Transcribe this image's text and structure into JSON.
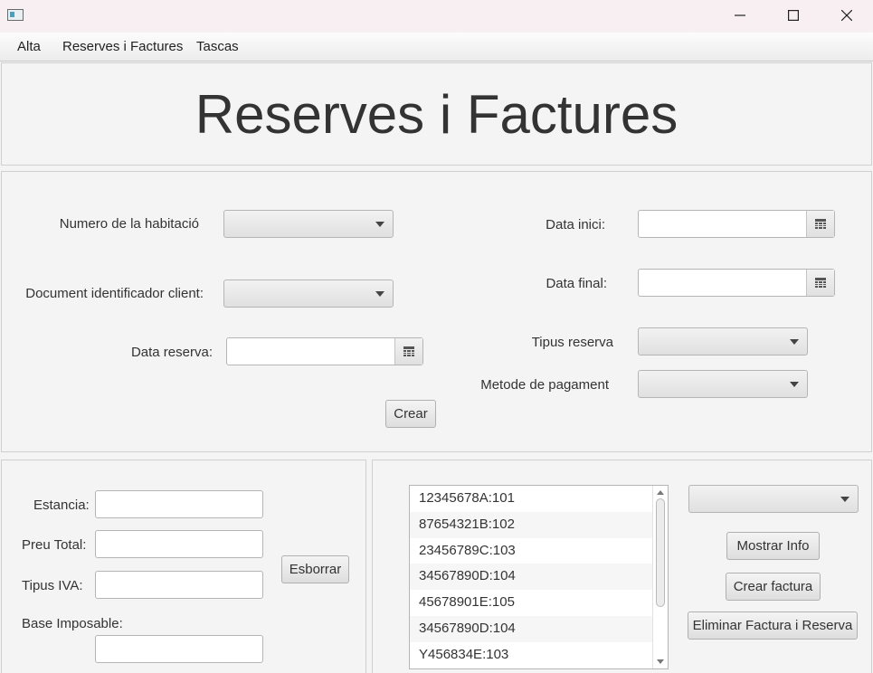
{
  "window": {
    "icon": "app-window-icon",
    "controls": [
      "minimize-icon",
      "maximize-icon",
      "close-icon"
    ]
  },
  "menu": {
    "items": [
      "Alta",
      "Reserves i Factures",
      "Tascas"
    ]
  },
  "header": {
    "title": "Reserves i Factures"
  },
  "form": {
    "room_number_label": "Numero de la habitació",
    "client_doc_label": "Document identificador client:",
    "booking_date_label": "Data reserva:",
    "start_date_label": "Data inici:",
    "end_date_label": "Data final:",
    "booking_type_label": "Tipus reserva",
    "payment_method_label": "Metode de pagament",
    "create_button": "Crear"
  },
  "invoice": {
    "stay_label": "Estancia:",
    "total_label": "Preu Total:",
    "vat_label": "Tipus IVA:",
    "tax_base_label": "Base Imposable:",
    "clear_button": "Esborrar"
  },
  "bookings": {
    "items": [
      "12345678A:101",
      "87654321B:102",
      "23456789C:103",
      "34567890D:104",
      "45678901E:105",
      "34567890D:104",
      "Y456834E:103"
    ],
    "show_info_button": "Mostrar Info",
    "create_invoice_button": "Crear factura",
    "delete_button": "Eliminar Factura i Reserva"
  },
  "colors": {
    "background": "#f4f4f4",
    "titlebar": "#f7eff1",
    "border": "#cfcfcf"
  }
}
